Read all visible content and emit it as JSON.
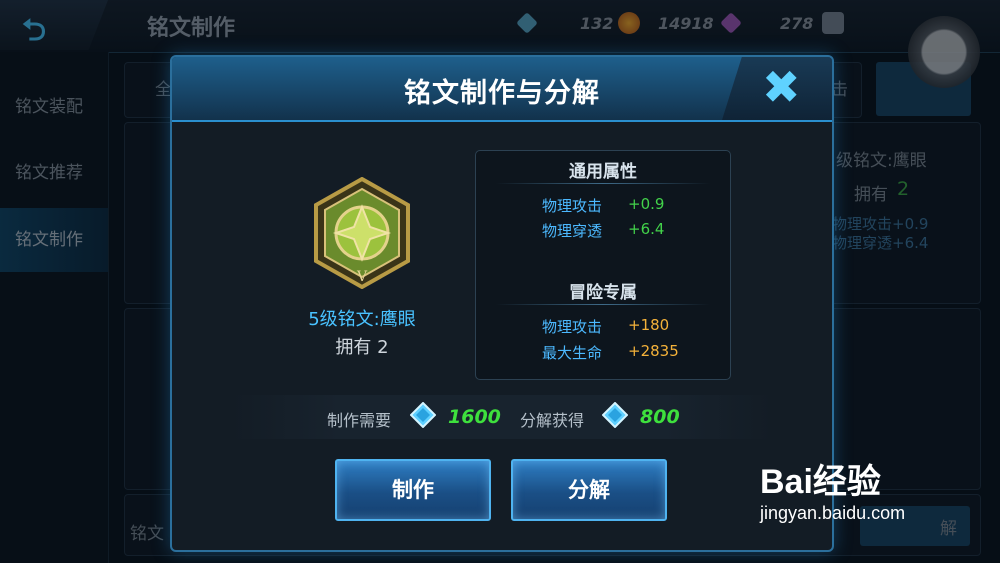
{
  "app": {
    "title": "铭文制作",
    "resources": {
      "diamond_count": "132",
      "coin_count": "14918",
      "gem_count": "278"
    }
  },
  "sidebar": {
    "items": [
      {
        "label": "铭文装配"
      },
      {
        "label": "铭文推荐"
      },
      {
        "label": "铭文制作",
        "active": true
      }
    ]
  },
  "background": {
    "tab_partial": "全",
    "tab_right_partial": "击",
    "right_rune_name": "级铭文:鹰眼",
    "right_owned_label": "拥有",
    "right_owned_count": "2",
    "right_stat1": "物理攻击+0.9",
    "right_stat2": "物理穿透+6.4",
    "bottom_left_partial": "铭文",
    "bottom_right_partial": "解"
  },
  "dialog": {
    "title": "铭文制作与分解",
    "rune": {
      "name": "5级铭文:鹰眼",
      "owned": "拥有 2"
    },
    "general": {
      "heading": "通用属性",
      "stats": [
        {
          "name": "物理攻击",
          "value": "+0.9"
        },
        {
          "name": "物理穿透",
          "value": "+6.4"
        }
      ]
    },
    "adventure": {
      "heading": "冒险专属",
      "stats": [
        {
          "name": "物理攻击",
          "value": "+180"
        },
        {
          "name": "最大生命",
          "value": "+2835"
        }
      ]
    },
    "craft_cost": {
      "label": "制作需要",
      "value": "1600"
    },
    "decompose_gain": {
      "label": "分解获得",
      "value": "800"
    },
    "buttons": {
      "craft": "制作",
      "decompose": "分解"
    }
  },
  "watermark": {
    "logo": "Bai经验",
    "url": "jingyan.baidu.com"
  },
  "colors": {
    "accent": "#2b8fd0",
    "stat_green": "#42d24a",
    "stat_orange": "#f4b23a",
    "rune_name": "#49c2ff"
  }
}
